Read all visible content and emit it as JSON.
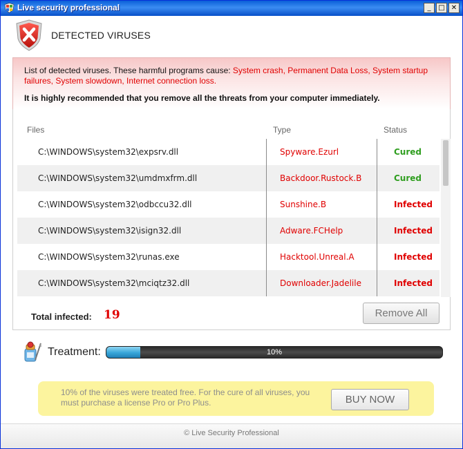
{
  "window": {
    "title": "Live security professional",
    "minimize": "_",
    "maximize": "□",
    "close": "✕"
  },
  "header": {
    "title": "DETECTED VIRUSES",
    "icon": "shield-x-icon"
  },
  "alert": {
    "intro": "List of detected viruses. These harmful programs cause: ",
    "consequences": "System crash, Permanent Data Loss, System startup failures, System slowdown, Internet connection loss.",
    "recommendation": "It is highly recommended that you remove all the threats from your computer immediately."
  },
  "table": {
    "columns": [
      "Files",
      "Type",
      "Status"
    ],
    "rows": [
      {
        "file": "C:\\WINDOWS\\system32\\expsrv.dll",
        "type": "Spyware.Ezurl",
        "status": "Cured"
      },
      {
        "file": "C:\\WINDOWS\\system32\\umdmxfrm.dll",
        "type": "Backdoor.Rustock.B",
        "status": "Cured"
      },
      {
        "file": "C:\\WINDOWS\\system32\\odbccu32.dll",
        "type": "Sunshine.B",
        "status": "Infected"
      },
      {
        "file": "C:\\WINDOWS\\system32\\isign32.dll",
        "type": "Adware.FCHelp",
        "status": "Infected"
      },
      {
        "file": "C:\\WINDOWS\\system32\\runas.exe",
        "type": "Hacktool.Unreal.A",
        "status": "Infected"
      },
      {
        "file": "C:\\WINDOWS\\system32\\mciqtz32.dll",
        "type": "Downloader.Jadelile",
        "status": "Infected"
      }
    ]
  },
  "summary": {
    "total_label": "Total infected:",
    "total_value": "19",
    "remove_all_label": "Remove All"
  },
  "treatment": {
    "label": "Treatment:",
    "progress_percent": 10,
    "progress_text": "10%",
    "icon": "medicine-bottle-icon"
  },
  "offer": {
    "text": "10% of the viruses were treated free. For the cure of all viruses, you must purchase a license Pro or Pro Plus.",
    "buy_label": "BUY NOW"
  },
  "footer": {
    "text": "© Live Security Professional"
  },
  "colors": {
    "alert_red": "#e00000",
    "cured_green": "#2f9e1f",
    "titlebar_blue": "#0a5fd8",
    "offer_yellow": "#fcf49e",
    "progress_blue": "#37a5d8"
  }
}
